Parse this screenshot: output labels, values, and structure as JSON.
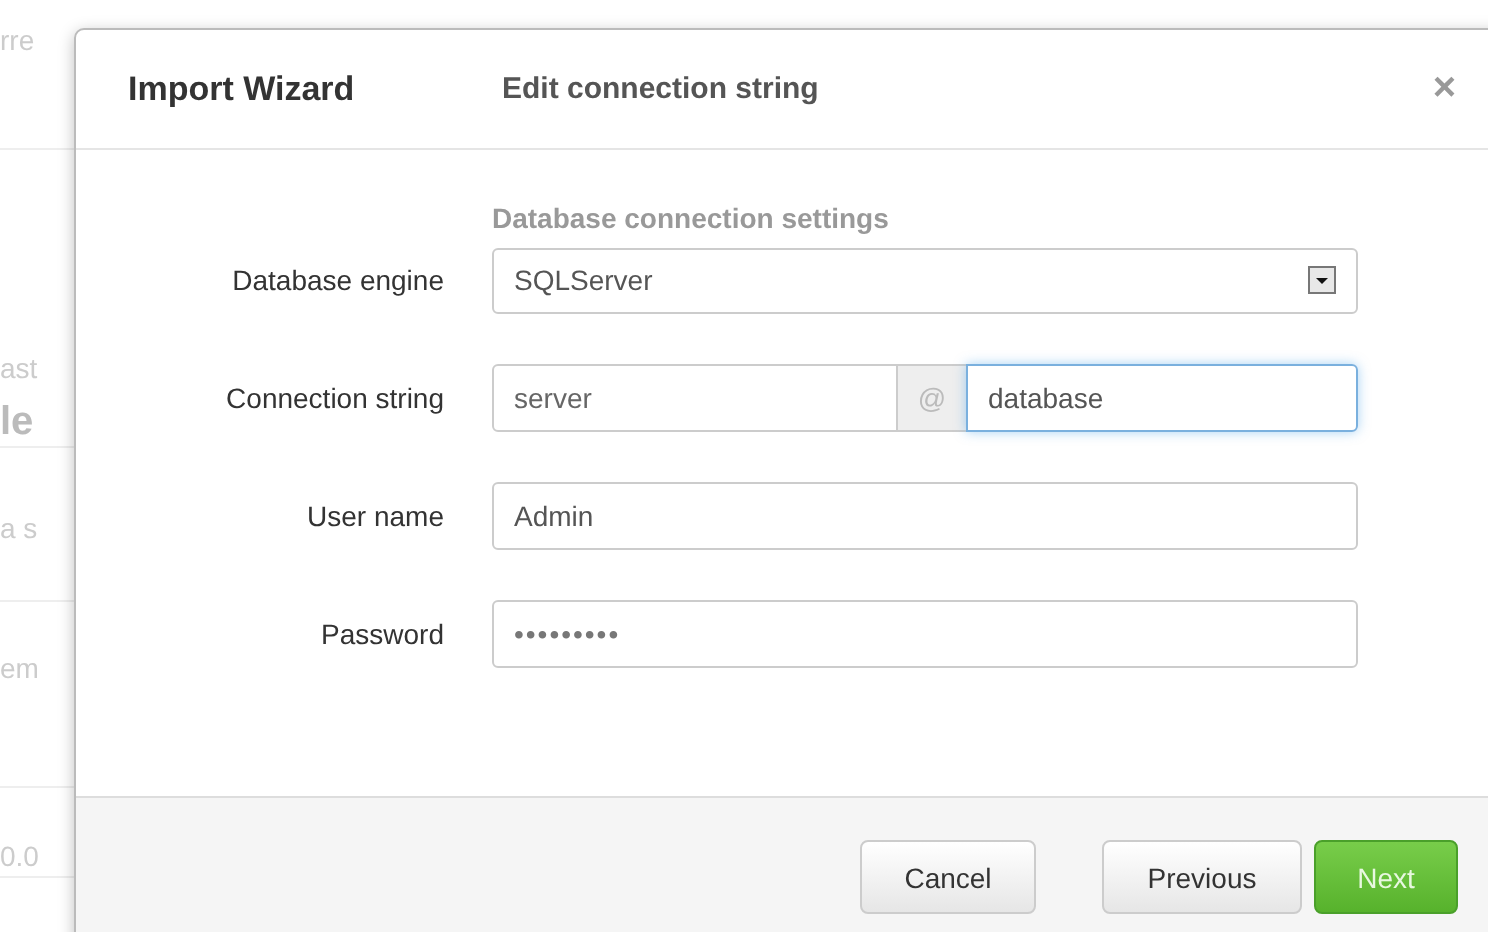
{
  "background_fragments": [
    "rre",
    "ast",
    "le",
    "a s",
    "em",
    "0.0"
  ],
  "dialog": {
    "title": "Import Wizard",
    "step_title": "Edit connection string",
    "close": "×"
  },
  "section_heading": "Database connection settings",
  "fields": [
    {
      "kind": "select",
      "label": "Database engine",
      "value": "SQLServer"
    },
    {
      "kind": "split",
      "label": "Connection string",
      "value": "server",
      "separator": "@",
      "second_value": "database",
      "second_focused": true
    },
    {
      "kind": "text",
      "label": "User name",
      "value": "Admin"
    },
    {
      "kind": "password",
      "label": "Password",
      "value": "•••••••••"
    }
  ],
  "buttons": [
    {
      "label": "Cancel",
      "kind": "default"
    },
    {
      "label": "Previous",
      "kind": "default"
    },
    {
      "label": "Next",
      "kind": "primary"
    }
  ]
}
